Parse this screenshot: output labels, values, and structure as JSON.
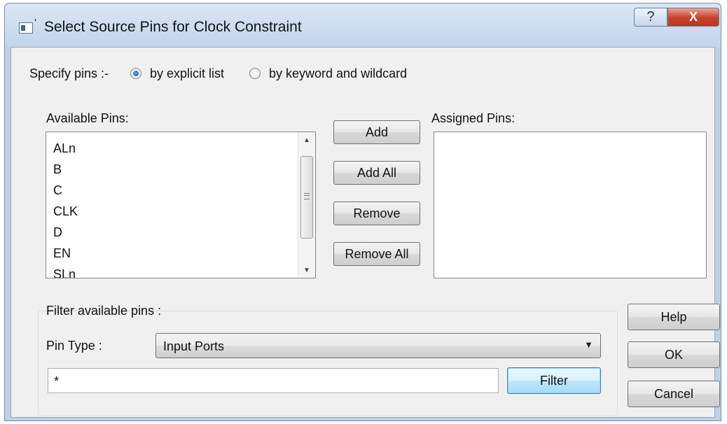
{
  "window": {
    "title": "Select Source Pins for Clock Constraint",
    "help_glyph": "?",
    "close_glyph": "X"
  },
  "specify": {
    "label": "Specify pins :-",
    "options": [
      {
        "label": "by explicit list",
        "checked": true
      },
      {
        "label": "by keyword and wildcard",
        "checked": false
      }
    ]
  },
  "available": {
    "label": "Available Pins:",
    "items": [
      "ALn",
      "B",
      "C",
      "CLK",
      "D",
      "EN",
      "SLn"
    ]
  },
  "assigned": {
    "label": "Assigned Pins:",
    "items": []
  },
  "actions": {
    "add": "Add",
    "add_all": "Add All",
    "remove": "Remove",
    "remove_all": "Remove All"
  },
  "filter": {
    "group_label": "Filter available pins :",
    "pin_type_label": "Pin Type :",
    "pin_type_value": "Input Ports",
    "pattern_value": "*",
    "filter_button": "Filter"
  },
  "dialog_buttons": {
    "help": "Help",
    "ok": "OK",
    "cancel": "Cancel"
  },
  "colors": {
    "title_bar": "#c2d5ec",
    "close_button": "#c7402a",
    "dialog_bg": "#f0f0f0",
    "radio_selected": "#1e4f96"
  },
  "icons": {
    "title": "window-app-icon",
    "scroll_up": "triangle-up",
    "scroll_down": "triangle-down",
    "dropdown": "triangle-down"
  }
}
